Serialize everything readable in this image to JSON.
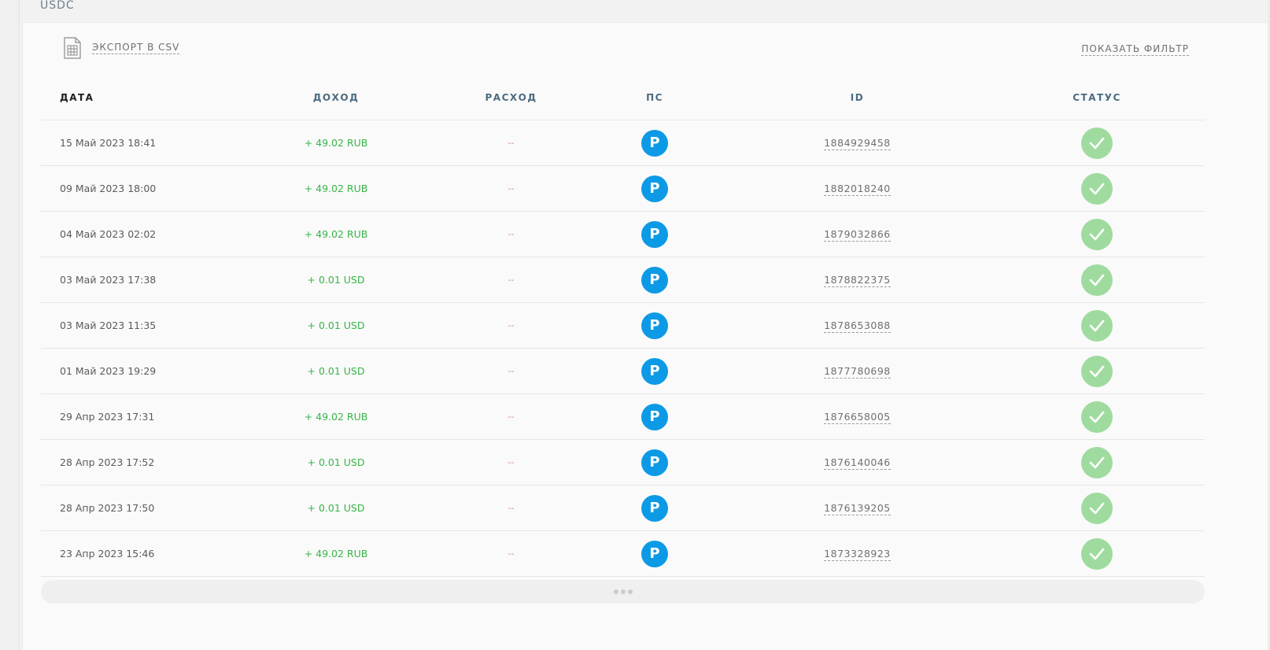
{
  "currency_tab": "USDC",
  "toolbar": {
    "export_label": "ЭКСПОРТ В CSV",
    "filter_label": "ПОКАЗАТЬ ФИЛЬТР"
  },
  "table": {
    "headers": [
      "ДАТА",
      "ДОХОД",
      "РАСХОД",
      "ПС",
      "ID",
      "СТАТУС"
    ],
    "rows": [
      {
        "date": "15 Май 2023 18:41",
        "income": "+ 49.02 RUB",
        "expense": "--",
        "ps": "P",
        "id": "1884929458",
        "status": "success"
      },
      {
        "date": "09 Май 2023 18:00",
        "income": "+ 49.02 RUB",
        "expense": "--",
        "ps": "P",
        "id": "1882018240",
        "status": "success"
      },
      {
        "date": "04 Май 2023 02:02",
        "income": "+ 49.02 RUB",
        "expense": "--",
        "ps": "P",
        "id": "1879032866",
        "status": "success"
      },
      {
        "date": "03 Май 2023 17:38",
        "income": "+ 0.01 USD",
        "expense": "--",
        "ps": "P",
        "id": "1878822375",
        "status": "success"
      },
      {
        "date": "03 Май 2023 11:35",
        "income": "+ 0.01 USD",
        "expense": "--",
        "ps": "P",
        "id": "1878653088",
        "status": "success"
      },
      {
        "date": "01 Май 2023 19:29",
        "income": "+ 0.01 USD",
        "expense": "--",
        "ps": "P",
        "id": "1877780698",
        "status": "success"
      },
      {
        "date": "29 Апр 2023 17:31",
        "income": "+ 49.02 RUB",
        "expense": "--",
        "ps": "P",
        "id": "1876658005",
        "status": "success"
      },
      {
        "date": "28 Апр 2023 17:52",
        "income": "+ 0.01 USD",
        "expense": "--",
        "ps": "P",
        "id": "1876140046",
        "status": "success"
      },
      {
        "date": "28 Апр 2023 17:50",
        "income": "+ 0.01 USD",
        "expense": "--",
        "ps": "P",
        "id": "1876139205",
        "status": "success"
      },
      {
        "date": "23 Апр 2023 15:46",
        "income": "+ 49.02 RUB",
        "expense": "--",
        "ps": "P",
        "id": "1873328923",
        "status": "success"
      }
    ]
  },
  "icons": {
    "export": "spreadsheet-icon",
    "payment_system": "payeer-icon",
    "status": "check-icon",
    "load_more": "ellipsis-icon"
  },
  "colors": {
    "income": "#38b449",
    "expense": "#e28080",
    "ps_badge": "#0c9ae6",
    "status_ok": "#9fdb9f",
    "header_text": "#4d6b80"
  }
}
